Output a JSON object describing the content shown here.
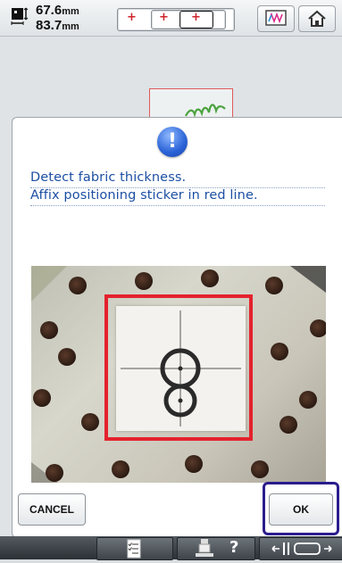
{
  "header": {
    "width_value": "67.6",
    "height_value": "83.7",
    "unit": "mm"
  },
  "dialog": {
    "message_line1": "Detect fabric thickness.",
    "message_line2": "Affix positioning sticker in red line.",
    "cancel_label": "CANCEL",
    "ok_label": "OK"
  },
  "footer": {
    "help_glyph": "?"
  },
  "icons": [
    "embroidery-size-icon",
    "hoop-small-icon",
    "hoop-medium-icon",
    "hoop-large-icon",
    "thread-color-icon",
    "home-icon",
    "info-icon",
    "checklist-icon",
    "presser-foot-help-icon",
    "hoop-move-icon"
  ],
  "colors": {
    "message_text": "#1d4fa3",
    "frame_red": "#e4222d",
    "ok_highlight": "#2a1d8c"
  }
}
